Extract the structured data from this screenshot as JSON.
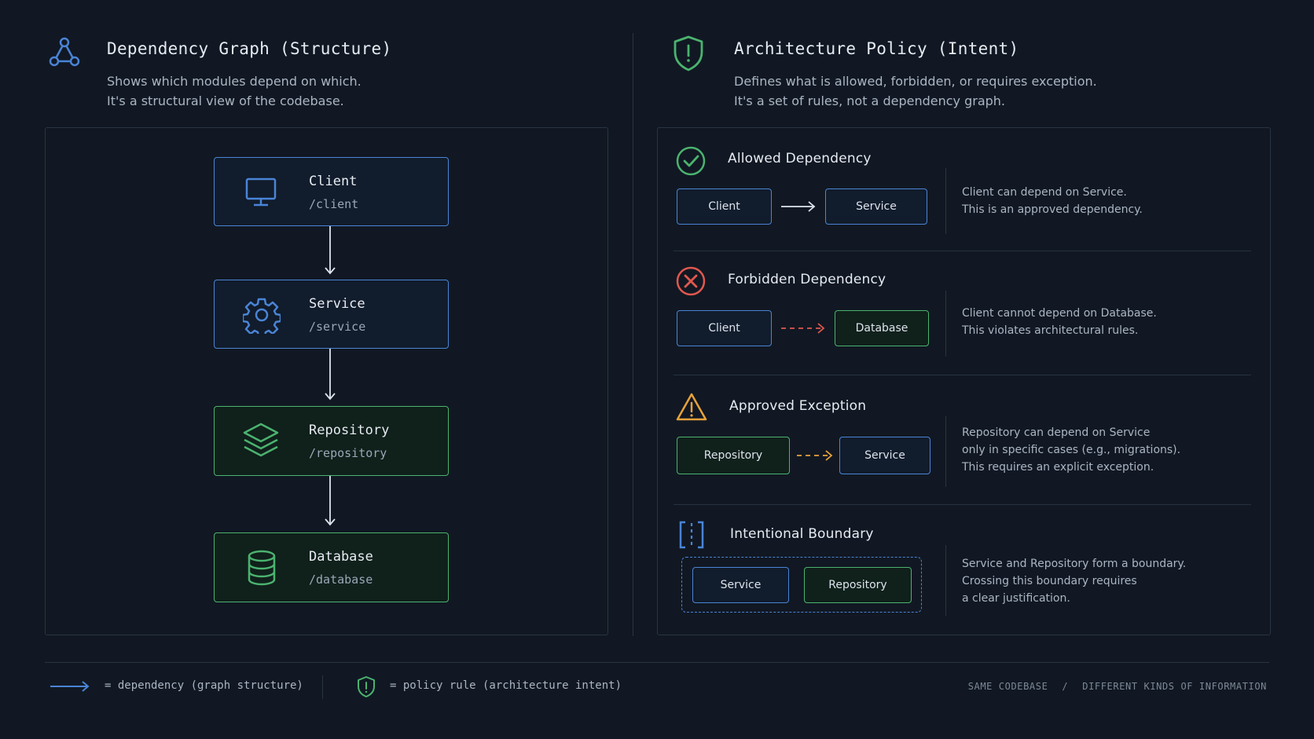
{
  "left": {
    "title": "Dependency Graph (Structure)",
    "subtitle_line1": "Shows which modules depend on which.",
    "subtitle_line2": "It's a structural view of the codebase.",
    "nodes": [
      {
        "title": "Client",
        "path": "/client",
        "icon": "monitor-icon",
        "color": "blue"
      },
      {
        "title": "Service",
        "path": "/service",
        "icon": "gear-icon",
        "color": "blue"
      },
      {
        "title": "Repository",
        "path": "/repository",
        "icon": "layers-icon",
        "color": "green"
      },
      {
        "title": "Database",
        "path": "/database",
        "icon": "database-icon",
        "color": "green"
      }
    ]
  },
  "right": {
    "title": "Architecture Policy (Intent)",
    "subtitle_line1": "Defines what is allowed, forbidden, or requires exception.",
    "subtitle_line2": "It's a set of rules, not a dependency graph.",
    "rules": [
      {
        "title": "Allowed Dependency",
        "icon": "check-circle-icon",
        "from": "Client",
        "to": "Service",
        "desc": [
          "Client can depend on Service.",
          "This is an approved dependency."
        ]
      },
      {
        "title": "Forbidden Dependency",
        "icon": "x-circle-icon",
        "from": "Client",
        "to": "Database",
        "desc": [
          "Client cannot depend on Database.",
          "This violates architectural rules."
        ]
      },
      {
        "title": "Approved Exception",
        "icon": "warning-triangle-icon",
        "from": "Repository",
        "to": "Service",
        "desc": [
          "Repository can depend on Service",
          "only in specific cases (e.g., migrations).",
          "This requires an explicit exception."
        ]
      },
      {
        "title": "Intentional Boundary",
        "icon": "boundary-icon",
        "from": "Service",
        "to": "Repository",
        "desc": [
          "Service and Repository form a boundary.",
          "Crossing this boundary requires",
          "a clear justification."
        ]
      }
    ]
  },
  "legend": {
    "dependency": "= dependency (graph structure)",
    "policy": "= policy rule (architecture intent)"
  },
  "footer": {
    "left": "SAME CODEBASE",
    "sep": "/",
    "right": "DIFFERENT KINDS OF INFORMATION"
  },
  "colors": {
    "background": "#111823",
    "blue": "#4a84d6",
    "green": "#4bb36f",
    "red": "#e0584f",
    "orange": "#e9a23b"
  }
}
